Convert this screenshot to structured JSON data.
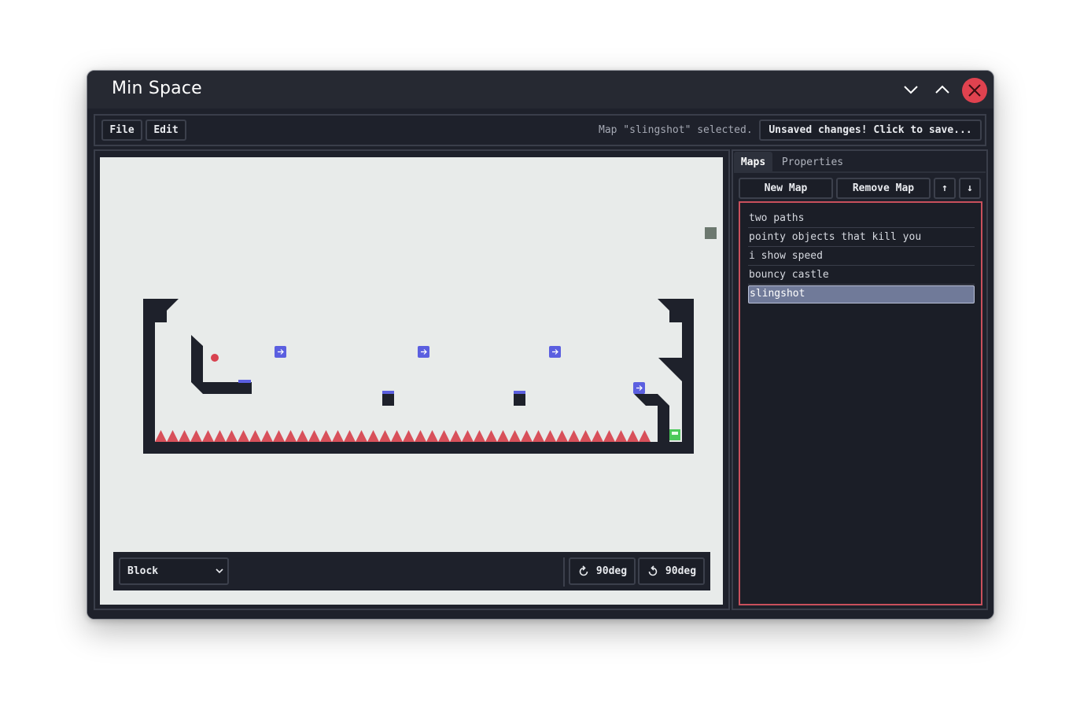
{
  "window": {
    "title": "Min Space"
  },
  "menu": {
    "file": "File",
    "edit": "Edit"
  },
  "status": {
    "message": "Map \"slingshot\" selected.",
    "save_button": "Unsaved changes! Click to save..."
  },
  "editor": {
    "tool_select": "Block",
    "rotate_cw_label": "90deg",
    "rotate_ccw_label": "90deg"
  },
  "sidebar": {
    "tabs": [
      {
        "label": "Maps",
        "active": true
      },
      {
        "label": "Properties",
        "active": false
      }
    ],
    "new_map": "New Map",
    "remove_map": "Remove Map",
    "move_up": "↑",
    "move_down": "↓",
    "maps": [
      {
        "name": "two paths",
        "selected": false
      },
      {
        "name": "pointy objects that kill you",
        "selected": false
      },
      {
        "name": "i show speed",
        "selected": false
      },
      {
        "name": "bouncy castle",
        "selected": false
      },
      {
        "name": "slingshot",
        "selected": true
      }
    ]
  },
  "colors": {
    "wall": "#1e212b",
    "spike": "#d8505a",
    "booster": "#5b5fe0",
    "ball": "#d84250",
    "goal": "#4cc95a",
    "close": "#e0424f",
    "list_border": "#c9505c"
  }
}
